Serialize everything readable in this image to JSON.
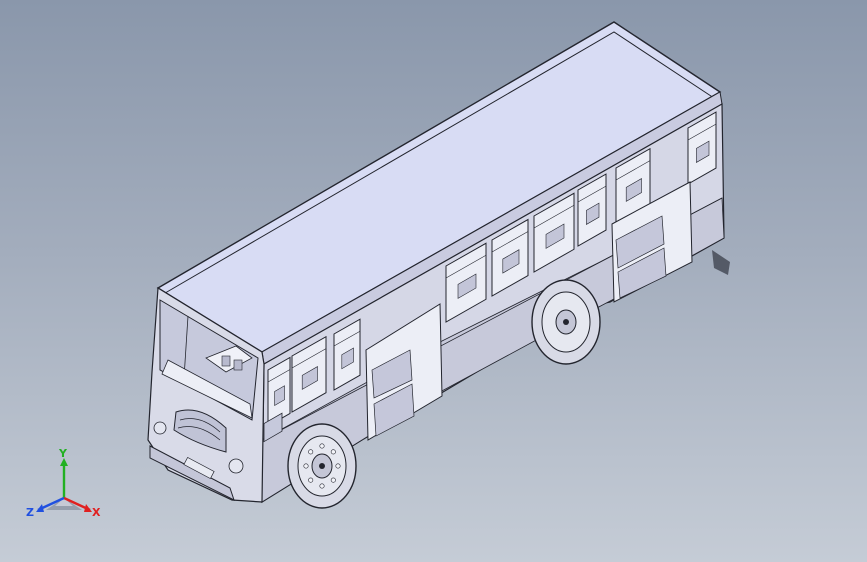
{
  "viewport": {
    "background_top": "#8a97ab",
    "background_bottom": "#c5ccd6"
  },
  "model": {
    "body_color": "#d9dbe8",
    "roof_color": "#d8dcf4",
    "outline_color": "#23252e"
  },
  "triad": {
    "x_label": "X",
    "y_label": "Y",
    "z_label": "Z",
    "x_color": "#e02020",
    "y_color": "#22b022",
    "z_color": "#2050e0"
  }
}
